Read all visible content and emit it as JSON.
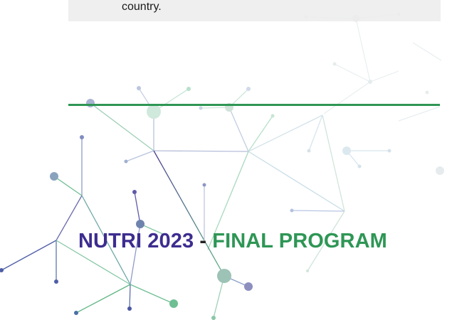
{
  "intro": {
    "text": "country."
  },
  "title": {
    "event": "NUTRI 2023",
    "separator": " - ",
    "program": "FINAL PROGRAM"
  },
  "colors": {
    "event_purple": "#3d2d8f",
    "program_green": "#2e9655",
    "divider_green": "#2e9655",
    "intro_box_grey": "#ececec"
  }
}
